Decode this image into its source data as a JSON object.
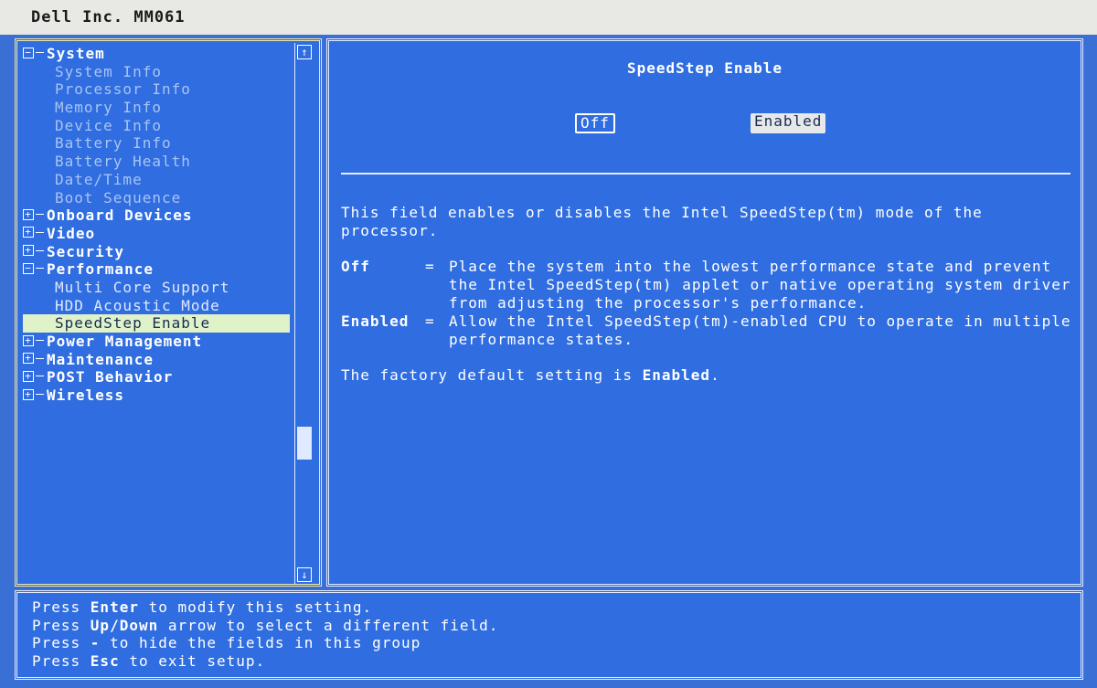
{
  "window": {
    "title": "Dell Inc. MM061"
  },
  "tree": {
    "items": [
      {
        "label": "System",
        "type": "group",
        "expanded": true
      },
      {
        "label": "System Info",
        "type": "child"
      },
      {
        "label": "Processor Info",
        "type": "child"
      },
      {
        "label": "Memory Info",
        "type": "child"
      },
      {
        "label": "Device Info",
        "type": "child"
      },
      {
        "label": "Battery Info",
        "type": "child"
      },
      {
        "label": "Battery Health",
        "type": "child"
      },
      {
        "label": "Date/Time",
        "type": "child"
      },
      {
        "label": "Boot Sequence",
        "type": "child"
      },
      {
        "label": "Onboard Devices",
        "type": "group",
        "expanded": false
      },
      {
        "label": "Video",
        "type": "group",
        "expanded": false
      },
      {
        "label": "Security",
        "type": "group",
        "expanded": false
      },
      {
        "label": "Performance",
        "type": "group",
        "expanded": true
      },
      {
        "label": "Multi Core Support",
        "type": "child",
        "active": true
      },
      {
        "label": "HDD Acoustic Mode",
        "type": "child",
        "active": true
      },
      {
        "label": "SpeedStep Enable",
        "type": "child",
        "selected": true
      },
      {
        "label": "Power Management",
        "type": "group",
        "expanded": false
      },
      {
        "label": "Maintenance",
        "type": "group",
        "expanded": false
      },
      {
        "label": "POST Behavior",
        "type": "group",
        "expanded": false
      },
      {
        "label": "Wireless",
        "type": "group",
        "expanded": false
      }
    ],
    "scroll_up_icon": "↑",
    "scroll_down_icon": "↓"
  },
  "setting": {
    "title": "SpeedStep Enable",
    "options": {
      "off": "Off",
      "enabled": "Enabled"
    },
    "selected_option": "Enabled",
    "description": "This field enables or disables the Intel SpeedStep(tm) mode of the processor.",
    "definitions": [
      {
        "term": "Off",
        "eq": "=",
        "text": "Place the system into the lowest performance state and prevent the Intel SpeedStep(tm) applet or native operating system driver from adjusting the processor's performance."
      },
      {
        "term": "Enabled",
        "eq": "=",
        "text": "Allow the Intel SpeedStep(tm)-enabled CPU to operate in multiple performance states."
      }
    ],
    "default_prefix": "The factory default setting is ",
    "default_value": "Enabled",
    "default_suffix": "."
  },
  "keys": [
    {
      "pre": "Press ",
      "key": "Enter",
      "post": " to modify this setting."
    },
    {
      "pre": "Press ",
      "key": "Up/Down",
      "post": " arrow to select a different field."
    },
    {
      "pre": "Press ",
      "key": "-",
      "post": " to hide the fields in this group"
    },
    {
      "pre": "Press ",
      "key": "Esc",
      "post": " to exit setup."
    }
  ],
  "colors": {
    "background": "#3a6fd6",
    "title_bar": "#e8e8e4",
    "selection": "#dff2c8"
  }
}
